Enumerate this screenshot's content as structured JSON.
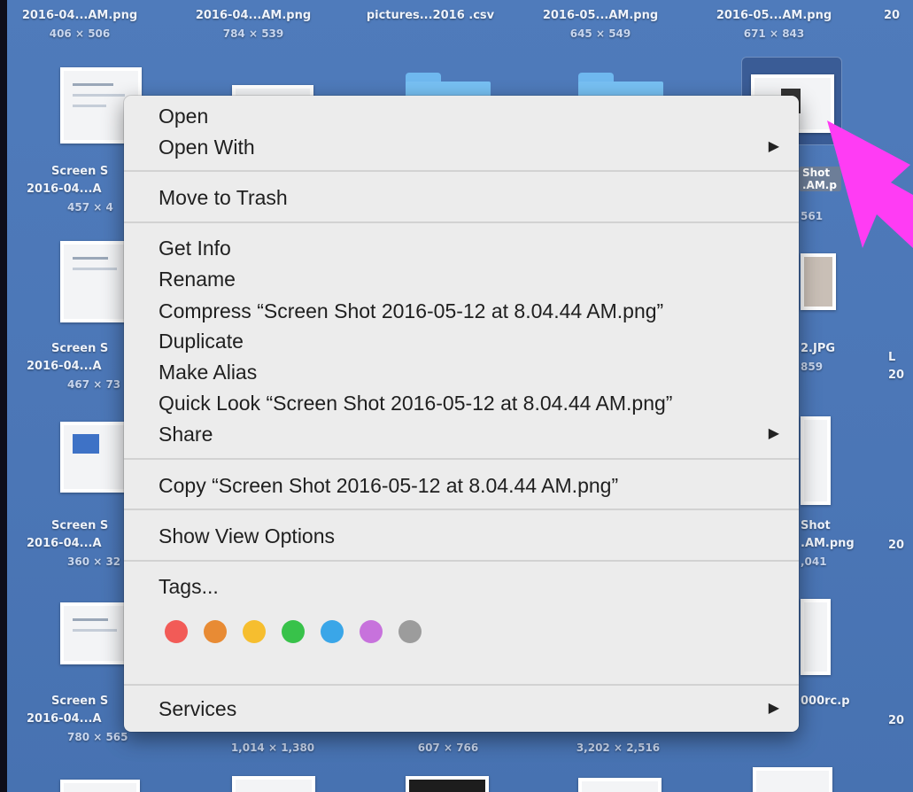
{
  "desktop": {
    "top_row": [
      {
        "name": "2016-04...AM.png",
        "dim": "406 × 506"
      },
      {
        "name": "2016-04...AM.png",
        "dim": "784 × 539"
      },
      {
        "name": "pictures...2016 .csv",
        "dim": ""
      },
      {
        "name": "2016-05...AM.png",
        "dim": "645 × 549"
      },
      {
        "name": "2016-05...AM.png",
        "dim": "671 × 843"
      },
      {
        "name": "20",
        "dim": ""
      }
    ],
    "left_column": [
      {
        "line1": "Screen S",
        "line2": "2016-04...A",
        "dim": "457 × 4"
      },
      {
        "line1": "Screen S",
        "line2": "2016-04...A",
        "dim": "467 × 73"
      },
      {
        "line1": "Screen S",
        "line2": "2016-04...A",
        "dim": "360 × 32"
      },
      {
        "line1": "Screen S",
        "line2": "2016-04...A",
        "dim": "780 × 565"
      }
    ],
    "right_column": [
      {
        "line1": "Shot",
        "line2": ".AM.p",
        "dim": "561"
      },
      {
        "line1": "2.JPG",
        "line2": "859",
        "dim": ""
      },
      {
        "line1": "Shot",
        "line2": ".AM.png",
        "dim": ",041"
      },
      {
        "line1": "000rc.p",
        "line2": "",
        "dim": ""
      }
    ],
    "far_right": [
      "L",
      "20",
      "20",
      "20"
    ],
    "bottom_dims": [
      "1,014 × 1,380",
      "607 × 766",
      "3,202 × 2,516"
    ]
  },
  "menu": {
    "open": "Open",
    "open_with": "Open With",
    "move_to_trash": "Move to Trash",
    "get_info": "Get Info",
    "rename": "Rename",
    "compress": "Compress “Screen Shot 2016-05-12 at 8.04.44 AM.png”",
    "duplicate": "Duplicate",
    "make_alias": "Make Alias",
    "quick_look": "Quick Look “Screen Shot 2016-05-12 at 8.04.44 AM.png”",
    "share": "Share",
    "copy": "Copy “Screen Shot 2016-05-12 at 8.04.44 AM.png”",
    "show_view_options": "Show View Options",
    "tags": "Tags...",
    "services": "Services",
    "submenu_arrow": "▶",
    "tag_colors": [
      "#f25b57",
      "#e88b34",
      "#f6be2f",
      "#38c24a",
      "#3aa6e8",
      "#c772dc",
      "#9c9c9c"
    ]
  },
  "annotation": {
    "arrow_color": "#ff3cf4"
  }
}
